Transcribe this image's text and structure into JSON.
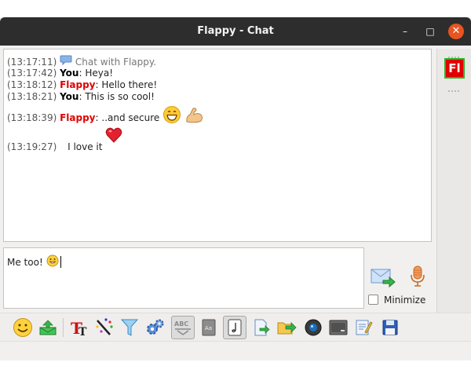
{
  "window": {
    "title": "Flappy - Chat",
    "minimize_glyph": "–",
    "maximize_glyph": "□",
    "close_glyph": "✕"
  },
  "history": [
    {
      "time": "(13:17:11)",
      "kind": "system",
      "text": "Chat with Flappy.",
      "icon": "chat-bubble-icon"
    },
    {
      "time": "(13:17:42)",
      "kind": "you",
      "sender": "You",
      "text": ": Heya!"
    },
    {
      "time": "(13:18:12)",
      "kind": "flappy",
      "sender": "Flappy",
      "text": ": Hello there!"
    },
    {
      "time": "(13:18:21)",
      "kind": "you",
      "sender": "You",
      "text": ": This is so cool!"
    },
    {
      "time": "(13:18:39)",
      "kind": "flappy",
      "sender": "Flappy",
      "text": ": ..and secure",
      "emoticons": [
        "grin-emoticon",
        "flexed-arm-emoticon"
      ]
    },
    {
      "time": "(13:19:27)",
      "kind": "you",
      "text": "I love it",
      "emoticons": [
        "heart-emoticon"
      ]
    }
  ],
  "input": {
    "value": "Me too!",
    "emoticon": "smile-emoticon"
  },
  "contact": {
    "avatar_text": "Fl",
    "avatar_color": "#e00000",
    "status_color": "#2ab52a"
  },
  "controls": {
    "minimize_label": "Minimize",
    "minimize_checked": false
  },
  "colors": {
    "you": "#000000",
    "flappy": "#e00000",
    "titlebar": "#2d2d2d",
    "close_button": "#e95420"
  },
  "toolbar": [
    {
      "name": "emoticons-button",
      "icon": "smiley-icon"
    },
    {
      "name": "nudge-button",
      "icon": "envelope-icon"
    },
    {
      "name": "font-button",
      "icon": "font-t-icon"
    },
    {
      "name": "text-color-button",
      "icon": "color-wand-icon"
    },
    {
      "name": "background-color-button",
      "icon": "funnel-icon"
    },
    {
      "name": "plugins-button",
      "icon": "gears-icon"
    },
    {
      "name": "spell-check-button",
      "icon": "abc-check-icon",
      "pressed": true
    },
    {
      "name": "dictionary-button",
      "icon": "book-icon"
    },
    {
      "name": "ink-button",
      "icon": "note-icon",
      "pressed": true
    },
    {
      "name": "send-file-button",
      "icon": "send-file-icon"
    },
    {
      "name": "send-folder-button",
      "icon": "folder-arrow-icon"
    },
    {
      "name": "webcam-button",
      "icon": "webcam-icon"
    },
    {
      "name": "screenshot-button",
      "icon": "screen-icon"
    },
    {
      "name": "history-button",
      "icon": "notes-pen-icon"
    },
    {
      "name": "save-button",
      "icon": "floppy-icon"
    }
  ]
}
